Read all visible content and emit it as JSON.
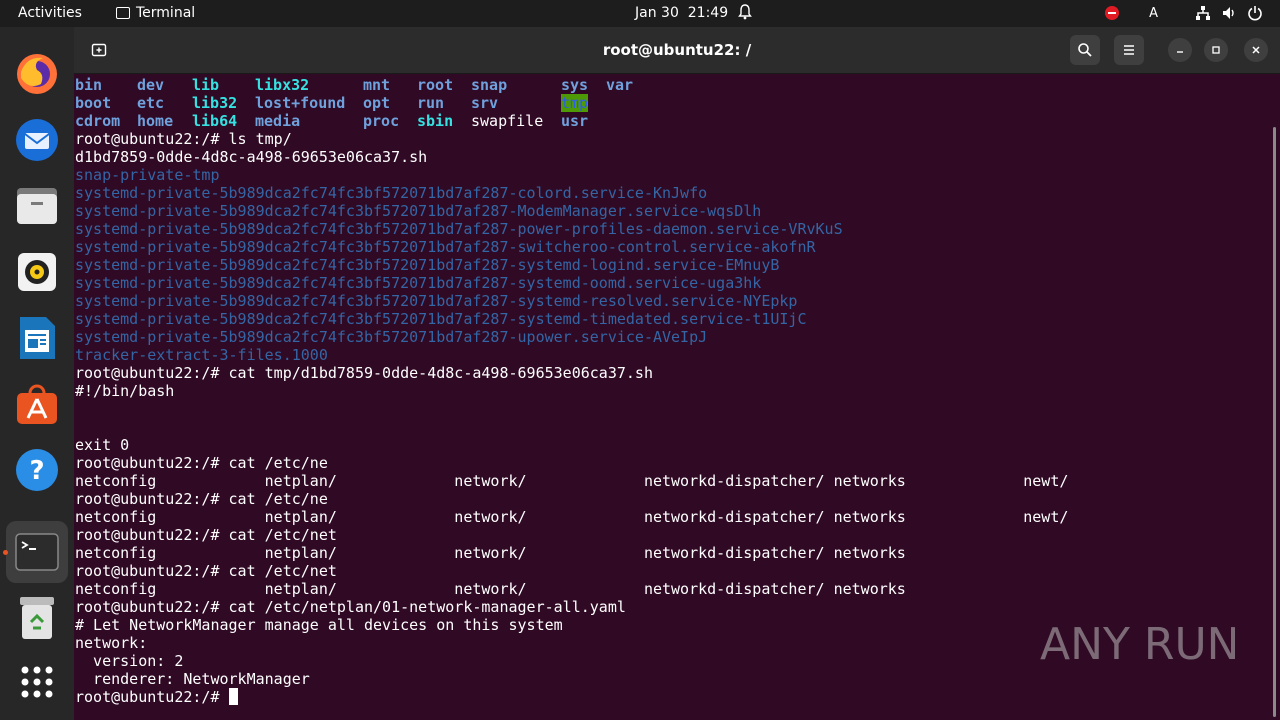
{
  "topbar": {
    "activities": "Activities",
    "app_name": "Terminal",
    "date": "Jan 30",
    "time": "21:49",
    "input_indicator": "A"
  },
  "window": {
    "title": "root@ubuntu22: /"
  },
  "watermark": "ANY RUN",
  "terminal": {
    "root_ls": [
      [
        {
          "t": "bin",
          "c": "bblue"
        },
        {
          "t": "dev",
          "c": "bblue"
        },
        {
          "t": "lib",
          "c": "cyan"
        },
        {
          "t": "libx32",
          "c": "cyan"
        },
        {
          "t": "mnt",
          "c": "bblue"
        },
        {
          "t": "root",
          "c": "bblue"
        },
        {
          "t": "snap",
          "c": "bblue"
        },
        {
          "t": "sys",
          "c": "bblue"
        },
        {
          "t": "var",
          "c": "bblue"
        }
      ],
      [
        {
          "t": "boot",
          "c": "bblue"
        },
        {
          "t": "etc",
          "c": "bblue"
        },
        {
          "t": "lib32",
          "c": "cyan"
        },
        {
          "t": "lost+found",
          "c": "bblue"
        },
        {
          "t": "opt",
          "c": "bblue"
        },
        {
          "t": "run",
          "c": "bblue"
        },
        {
          "t": "srv",
          "c": "bblue"
        },
        {
          "t": "tmp",
          "c": "greenbg"
        },
        {
          "t": "",
          "c": ""
        }
      ],
      [
        {
          "t": "cdrom",
          "c": "bblue"
        },
        {
          "t": "home",
          "c": "bblue"
        },
        {
          "t": "lib64",
          "c": "cyan"
        },
        {
          "t": "media",
          "c": "bblue"
        },
        {
          "t": "proc",
          "c": "bblue"
        },
        {
          "t": "sbin",
          "c": "cyan"
        },
        {
          "t": "swapfile",
          "c": "white"
        },
        {
          "t": "usr",
          "c": "bblue"
        },
        {
          "t": "",
          "c": ""
        }
      ]
    ],
    "lines_after": [
      {
        "t": "root@ubuntu22:/# ls tmp/",
        "c": "white"
      },
      {
        "t": "d1bd7859-0dde-4d8c-a498-69653e06ca37.sh",
        "c": "white"
      },
      {
        "t": "snap-private-tmp",
        "c": "blue"
      },
      {
        "t": "systemd-private-5b989dca2fc74fc3bf572071bd7af287-colord.service-KnJwfo",
        "c": "blue"
      },
      {
        "t": "systemd-private-5b989dca2fc74fc3bf572071bd7af287-ModemManager.service-wqsDlh",
        "c": "blue"
      },
      {
        "t": "systemd-private-5b989dca2fc74fc3bf572071bd7af287-power-profiles-daemon.service-VRvKuS",
        "c": "blue"
      },
      {
        "t": "systemd-private-5b989dca2fc74fc3bf572071bd7af287-switcheroo-control.service-akofnR",
        "c": "blue"
      },
      {
        "t": "systemd-private-5b989dca2fc74fc3bf572071bd7af287-systemd-logind.service-EMnuyB",
        "c": "blue"
      },
      {
        "t": "systemd-private-5b989dca2fc74fc3bf572071bd7af287-systemd-oomd.service-uga3hk",
        "c": "blue"
      },
      {
        "t": "systemd-private-5b989dca2fc74fc3bf572071bd7af287-systemd-resolved.service-NYEpkp",
        "c": "blue"
      },
      {
        "t": "systemd-private-5b989dca2fc74fc3bf572071bd7af287-systemd-timedated.service-t1UIjC",
        "c": "blue"
      },
      {
        "t": "systemd-private-5b989dca2fc74fc3bf572071bd7af287-upower.service-AVeIpJ",
        "c": "blue"
      },
      {
        "t": "tracker-extract-3-files.1000",
        "c": "blue"
      },
      {
        "t": "root@ubuntu22:/# cat tmp/d1bd7859-0dde-4d8c-a498-69653e06ca37.sh",
        "c": "white"
      },
      {
        "t": "#!/bin/bash",
        "c": "white"
      },
      {
        "t": "",
        "c": "white"
      },
      {
        "t": "",
        "c": "white"
      },
      {
        "t": "exit 0",
        "c": "white"
      },
      {
        "t": "root@ubuntu22:/# cat /etc/ne",
        "c": "white"
      },
      {
        "t": "netconfig            netplan/             network/             networkd-dispatcher/ networks             newt/",
        "c": "white"
      },
      {
        "t": "root@ubuntu22:/# cat /etc/ne",
        "c": "white"
      },
      {
        "t": "netconfig            netplan/             network/             networkd-dispatcher/ networks             newt/",
        "c": "white"
      },
      {
        "t": "root@ubuntu22:/# cat /etc/net",
        "c": "white"
      },
      {
        "t": "netconfig            netplan/             network/             networkd-dispatcher/ networks",
        "c": "white"
      },
      {
        "t": "root@ubuntu22:/# cat /etc/net",
        "c": "white"
      },
      {
        "t": "netconfig            netplan/             network/             networkd-dispatcher/ networks",
        "c": "white"
      },
      {
        "t": "root@ubuntu22:/# cat /etc/netplan/01-network-manager-all.yaml",
        "c": "white"
      },
      {
        "t": "# Let NetworkManager manage all devices on this system",
        "c": "white"
      },
      {
        "t": "network:",
        "c": "white"
      },
      {
        "t": "  version: 2",
        "c": "white"
      },
      {
        "t": "  renderer: NetworkManager",
        "c": "white"
      }
    ],
    "prompt": "root@ubuntu22:/# "
  },
  "dock": [
    "firefox-icon",
    "thunderbird-icon",
    "files-icon",
    "rhythmbox-icon",
    "libreoffice-writer-icon",
    "app-center-icon",
    "help-icon",
    "terminal-icon",
    "trash-icon",
    "show-apps-icon"
  ]
}
